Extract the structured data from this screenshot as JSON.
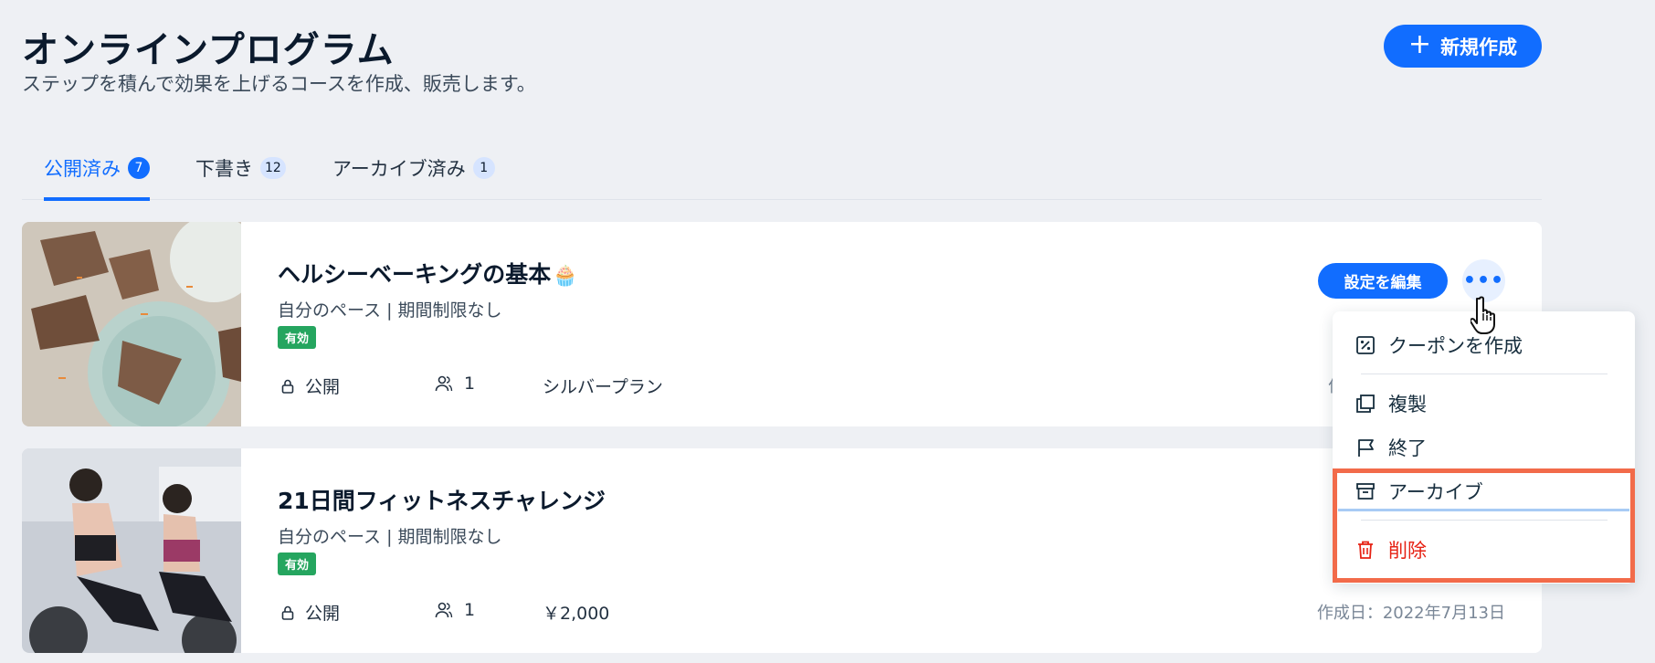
{
  "header": {
    "title": "オンラインプログラム",
    "subtitle": "ステップを積んで効果を上げるコースを作成、販売します。",
    "create_button": "新規作成"
  },
  "tabs": [
    {
      "label": "公開済み",
      "count": "7",
      "active": true
    },
    {
      "label": "下書き",
      "count": "12",
      "active": false
    },
    {
      "label": "アーカイブ済み",
      "count": "1",
      "active": false
    }
  ],
  "programs": [
    {
      "title": "ヘルシーベーキングの基本",
      "meta": "自分のペース | 期間制限なし",
      "status": "有効",
      "visibility": "公開",
      "participants": "1",
      "pricing": "シルバープラン",
      "created": "作",
      "edit_button": "設定を編集"
    },
    {
      "title": "21日間フィットネスチャレンジ",
      "meta": "自分のペース | 期間制限なし",
      "status": "有効",
      "visibility": "公開",
      "participants": "1",
      "pricing": "￥2,000",
      "created": "作成日：2022年7月13日"
    }
  ],
  "menu": {
    "items": [
      {
        "label": "クーポンを作成",
        "icon": "coupon-icon"
      },
      {
        "label": "複製",
        "icon": "duplicate-icon"
      },
      {
        "label": "終了",
        "icon": "flag-icon"
      },
      {
        "label": "アーカイブ",
        "icon": "archive-icon"
      },
      {
        "label": "削除",
        "icon": "trash-icon"
      }
    ]
  },
  "colors": {
    "accent": "#116dff",
    "badge_green": "#25a55f",
    "danger": "#e62214",
    "highlight": "#f26b4a"
  }
}
